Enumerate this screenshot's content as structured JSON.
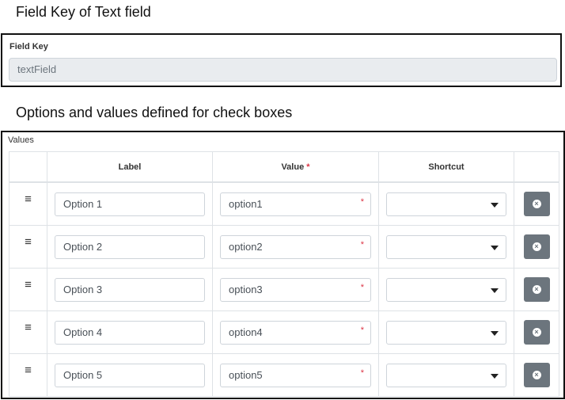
{
  "captions": {
    "field_key": "Field Key of Text field",
    "options": "Options and values defined for check boxes"
  },
  "field_key": {
    "label": "Field Key",
    "value": "textField"
  },
  "values_table": {
    "section_label": "Values",
    "headers": {
      "label": "Label",
      "value": "Value",
      "required_mark": "*",
      "shortcut": "Shortcut"
    },
    "rows": [
      {
        "label": "Option 1",
        "value": "option1",
        "shortcut": ""
      },
      {
        "label": "Option 2",
        "value": "option2",
        "shortcut": ""
      },
      {
        "label": "Option 3",
        "value": "option3",
        "shortcut": ""
      },
      {
        "label": "Option 4",
        "value": "option4",
        "shortcut": ""
      },
      {
        "label": "Option 5",
        "value": "option5",
        "shortcut": ""
      }
    ],
    "icons": {
      "drag": "≡",
      "required": "*",
      "remove": "×"
    }
  },
  "colors": {
    "remove_button": "#6c757d",
    "required": "#dc3545",
    "readonly_input": "#e9ecef"
  }
}
